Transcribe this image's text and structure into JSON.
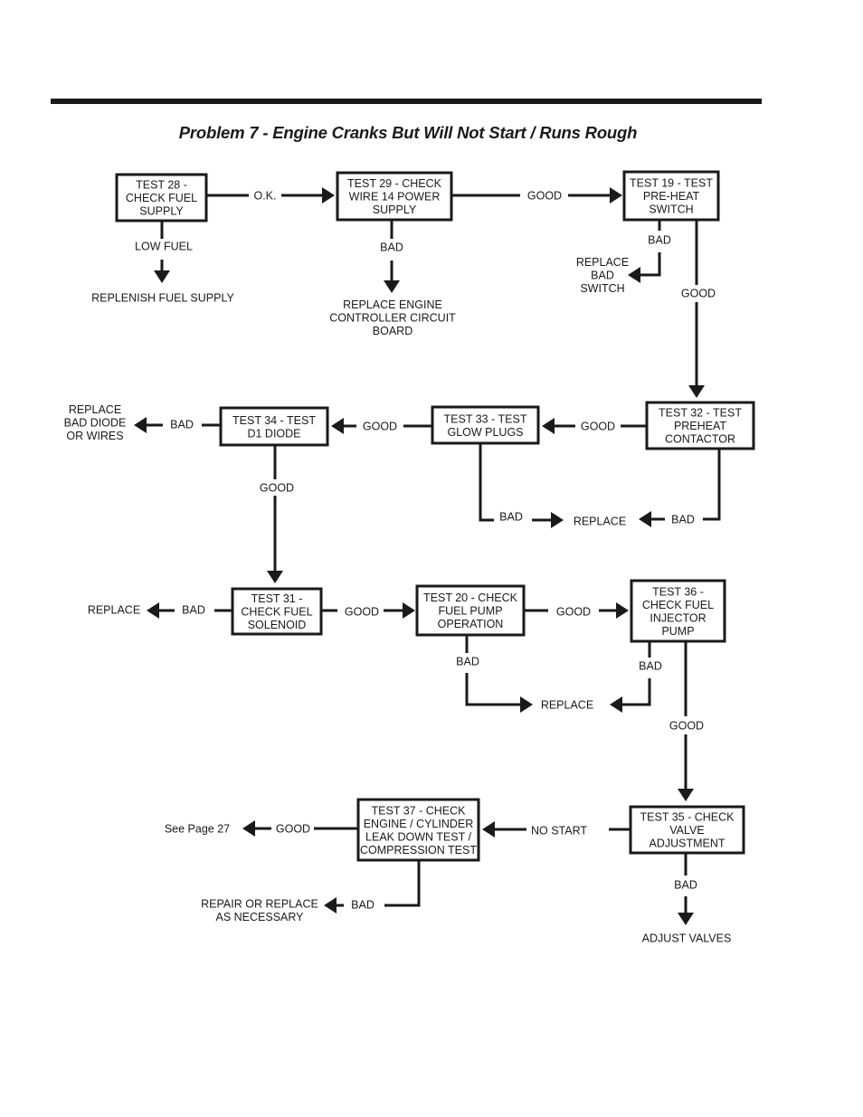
{
  "title": "Problem 7 -  Engine Cranks But Will Not Start / Runs Rough",
  "nodes": {
    "test28": [
      "TEST 28 -",
      "CHECK FUEL",
      "SUPPLY"
    ],
    "test29": [
      "TEST 29 - CHECK",
      "WIRE 14 POWER",
      "SUPPLY"
    ],
    "test19": [
      "TEST 19 - TEST",
      "PRE-HEAT",
      "SWITCH"
    ],
    "test32": [
      "TEST 32 - TEST",
      "PREHEAT",
      "CONTACTOR"
    ],
    "test33": [
      "TEST 33 - TEST",
      "GLOW PLUGS"
    ],
    "test34": [
      "TEST 34 - TEST",
      "D1 DIODE"
    ],
    "test31": [
      "TEST 31 -",
      "CHECK FUEL",
      "SOLENOID"
    ],
    "test20": [
      "TEST 20 - CHECK",
      "FUEL PUMP",
      "OPERATION"
    ],
    "test36": [
      "TEST 36 -",
      "CHECK FUEL",
      "INJECTOR",
      "PUMP"
    ],
    "test35": [
      "TEST 35 - CHECK",
      "VALVE",
      "ADJUSTMENT"
    ],
    "test37": [
      "TEST 37 - CHECK",
      "ENGINE / CYLINDER",
      "LEAK DOWN TEST /",
      "COMPRESSION TEST"
    ]
  },
  "outcomes": {
    "replenish_fuel": [
      "REPLENISH FUEL SUPPLY"
    ],
    "replace_controller": [
      "REPLACE ENGINE",
      "CONTROLLER CIRCUIT",
      "BOARD"
    ],
    "replace_switch": [
      "REPLACE",
      "BAD",
      "SWITCH"
    ],
    "replace_diode": [
      "REPLACE",
      "BAD DIODE",
      "OR WIRES"
    ],
    "replace_glow": [
      "REPLACE"
    ],
    "replace_solenoid": [
      "REPLACE"
    ],
    "replace_pump": [
      "REPLACE"
    ],
    "see_page": [
      "See Page 27"
    ],
    "repair_replace": [
      "REPAIR OR REPLACE",
      "AS NECESSARY"
    ],
    "adjust_valves": [
      "ADJUST VALVES"
    ]
  },
  "edges": {
    "e28_29": "O.K.",
    "e28_low": "LOW FUEL",
    "e29_19": "GOOD",
    "e29_bad": "BAD",
    "e19_bad": "BAD",
    "e19_32": "GOOD",
    "e32_33": "GOOD",
    "e32_bad": "BAD",
    "e33_34": "GOOD",
    "e33_bad": "BAD",
    "e34_bad": "BAD",
    "e34_31": "GOOD",
    "e31_bad": "BAD",
    "e31_20": "GOOD",
    "e20_36": "GOOD",
    "e20_bad": "BAD",
    "e36_bad": "BAD",
    "e36_35": "GOOD",
    "e35_37": "NO START",
    "e35_bad": "BAD",
    "e37_good": "GOOD",
    "e37_bad": "BAD"
  }
}
